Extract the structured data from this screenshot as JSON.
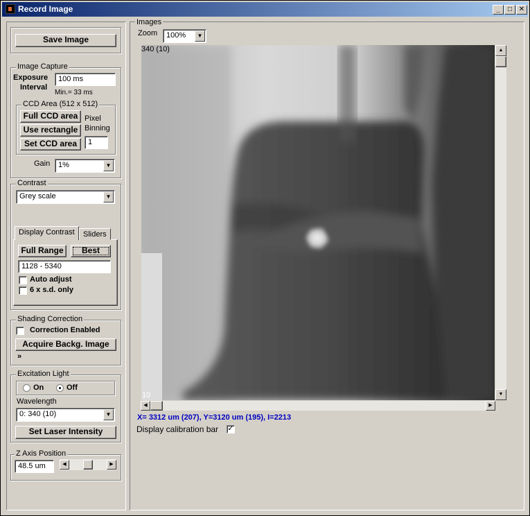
{
  "window": {
    "title": "Record Image"
  },
  "left": {
    "save_image": "Save Image",
    "image_capture": {
      "title": "Image Capture",
      "exposure_label_1": "Exposure",
      "exposure_label_2": "Interval",
      "exposure_value": "100 ms",
      "min_note": "Min.= 33 ms",
      "ccd_title": "CCD Area (512 x 512)",
      "full_ccd": "Full CCD area",
      "use_rect": "Use rectangle",
      "set_ccd": "Set CCD area",
      "pixel_label_1": "Pixel",
      "pixel_label_2": "Binning",
      "binning_value": "1",
      "gain_label": "Gain",
      "gain_value": "1%"
    },
    "contrast": {
      "title": "Contrast",
      "palette": "Grey scale",
      "tab_display": "Display Contrast",
      "tab_sliders": "Sliders",
      "full_range": "Full Range",
      "best": "Best",
      "range_value": "1128 - 5340",
      "auto_adjust": "Auto adjust",
      "six_sd": "6 x s.d. only"
    },
    "shading": {
      "title": "Shading Correction",
      "enabled": "Correction Enabled",
      "acquire": "Acquire Backg. Image"
    },
    "excitation": {
      "title": "Excitation Light",
      "on": "On",
      "off": "Off",
      "selected": "off",
      "wavelength_label": "Wavelength",
      "wavelength_value": "0: 340 (10)",
      "set_laser": "Set Laser Intensity"
    },
    "z_axis": {
      "title": "Z Axis Position",
      "value": "48.5 um",
      "slider_position": 0.5
    }
  },
  "images": {
    "title": "Images",
    "zoom_label": "Zoom",
    "zoom_value": "100%",
    "image_label": "340 (10)",
    "corner_label": "10",
    "status": "X= 3312 um (207), Y=3120 um (195), I=2213",
    "calib_label": "Display calibration bar",
    "calib_checked": true
  },
  "colors": {
    "title_start": "#0a246a",
    "title_end": "#a6caf0",
    "status_text": "#0000c0"
  },
  "icons": [
    "minimize-icon",
    "maximize-icon",
    "close-icon",
    "chevron-down-icon",
    "double-chevron-down-icon",
    "arrow-left-icon",
    "arrow-right-icon",
    "arrow-up-icon",
    "arrow-down-icon"
  ]
}
